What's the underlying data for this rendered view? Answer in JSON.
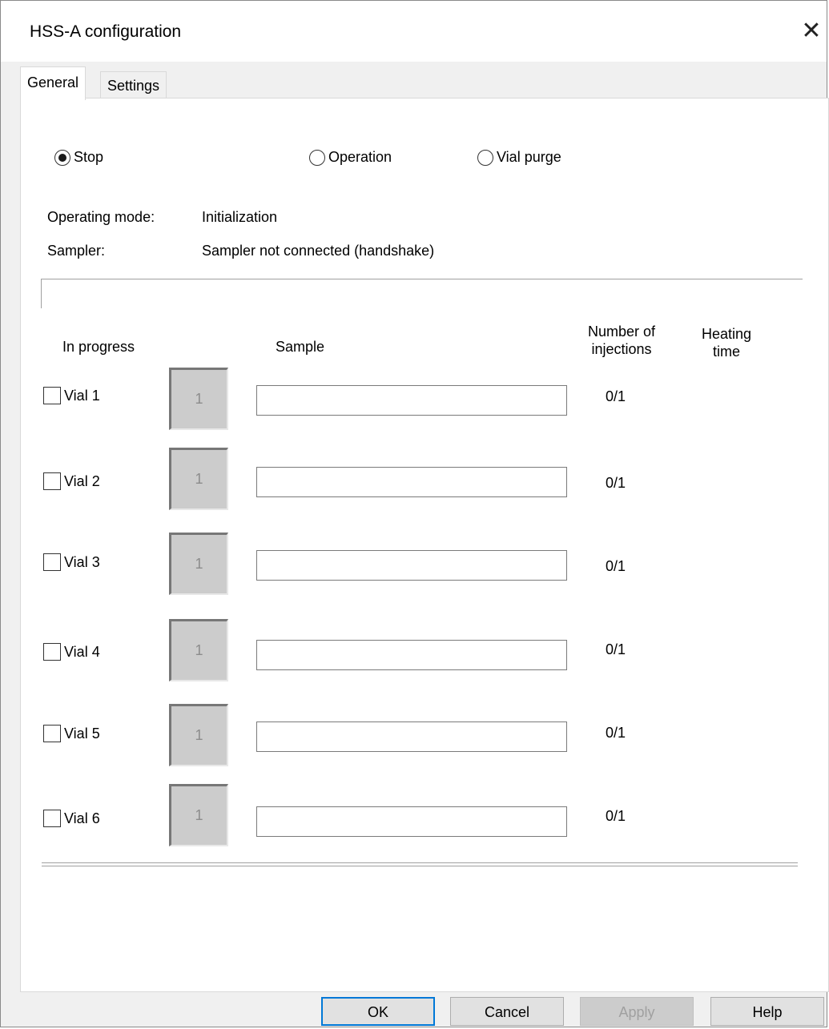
{
  "window": {
    "title": "HSS-A configuration"
  },
  "tabs": [
    {
      "label": "General",
      "active": true
    },
    {
      "label": "Settings",
      "active": false
    }
  ],
  "mode_options": [
    {
      "label": "Stop",
      "checked": true
    },
    {
      "label": "Operation",
      "checked": false
    },
    {
      "label": "Vial purge",
      "checked": false
    }
  ],
  "status": {
    "operating_mode_label": "Operating mode:",
    "operating_mode_value": "Initialization",
    "sampler_label": "Sampler:",
    "sampler_value": "Sampler not connected (handshake)"
  },
  "columns": {
    "in_progress": "In progress",
    "sample": "Sample",
    "injections_line1": "Number of",
    "injections_line2": "injections",
    "heating_line1": "Heating",
    "heating_line2": "time"
  },
  "vials": [
    {
      "label": "Vial 1",
      "checked": false,
      "count": "1",
      "sample": "",
      "injections": "0/1"
    },
    {
      "label": "Vial 2",
      "checked": false,
      "count": "1",
      "sample": "",
      "injections": "0/1"
    },
    {
      "label": "Vial 3",
      "checked": false,
      "count": "1",
      "sample": "",
      "injections": "0/1"
    },
    {
      "label": "Vial 4",
      "checked": false,
      "count": "1",
      "sample": "",
      "injections": "0/1"
    },
    {
      "label": "Vial 5",
      "checked": false,
      "count": "1",
      "sample": "",
      "injections": "0/1"
    },
    {
      "label": "Vial 6",
      "checked": false,
      "count": "1",
      "sample": "",
      "injections": "0/1"
    }
  ],
  "buttons": {
    "ok": "OK",
    "cancel": "Cancel",
    "apply": "Apply",
    "help": "Help"
  },
  "icons": {
    "close": "close-icon"
  },
  "colors": {
    "default_button_border": "#0078d7"
  }
}
